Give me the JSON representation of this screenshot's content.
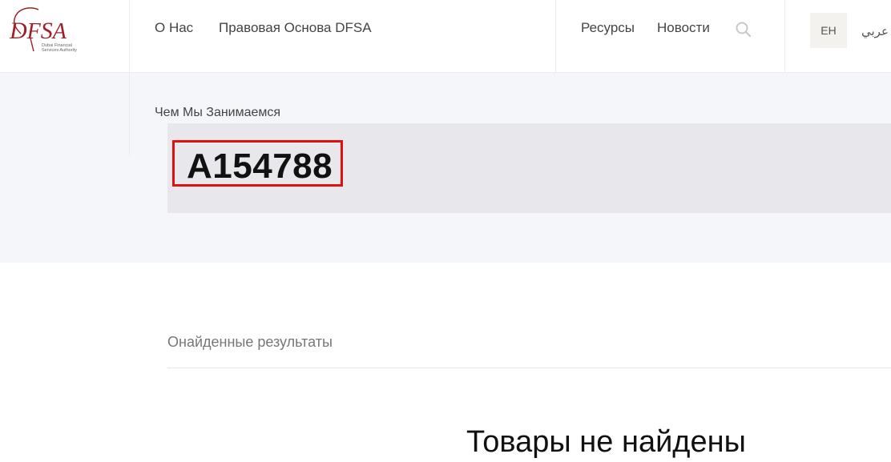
{
  "header": {
    "logo": {
      "mark": "DFSA",
      "subtitle_line1": "Dubai Financial",
      "subtitle_line2": "Services Authority"
    },
    "nav_left": [
      {
        "label": "О Нас"
      },
      {
        "label": "Правовая Основа DFSA"
      }
    ],
    "nav_right": [
      {
        "label": "Ресурсы"
      },
      {
        "label": "Новости"
      }
    ],
    "search_icon": "search-icon",
    "lang_en": "ЕН",
    "lang_ar": "عربي"
  },
  "hero": {
    "breadcrumb": "Чем Мы Занимаемся",
    "title": "A154788"
  },
  "results": {
    "label": "Онайденные результаты",
    "empty_message": "Товары не найдены"
  },
  "colors": {
    "brand_red": "#a0202a",
    "highlight_red": "#e01010",
    "hero_bg": "#f5f6f9",
    "title_box_bg": "#e8e8ec"
  }
}
